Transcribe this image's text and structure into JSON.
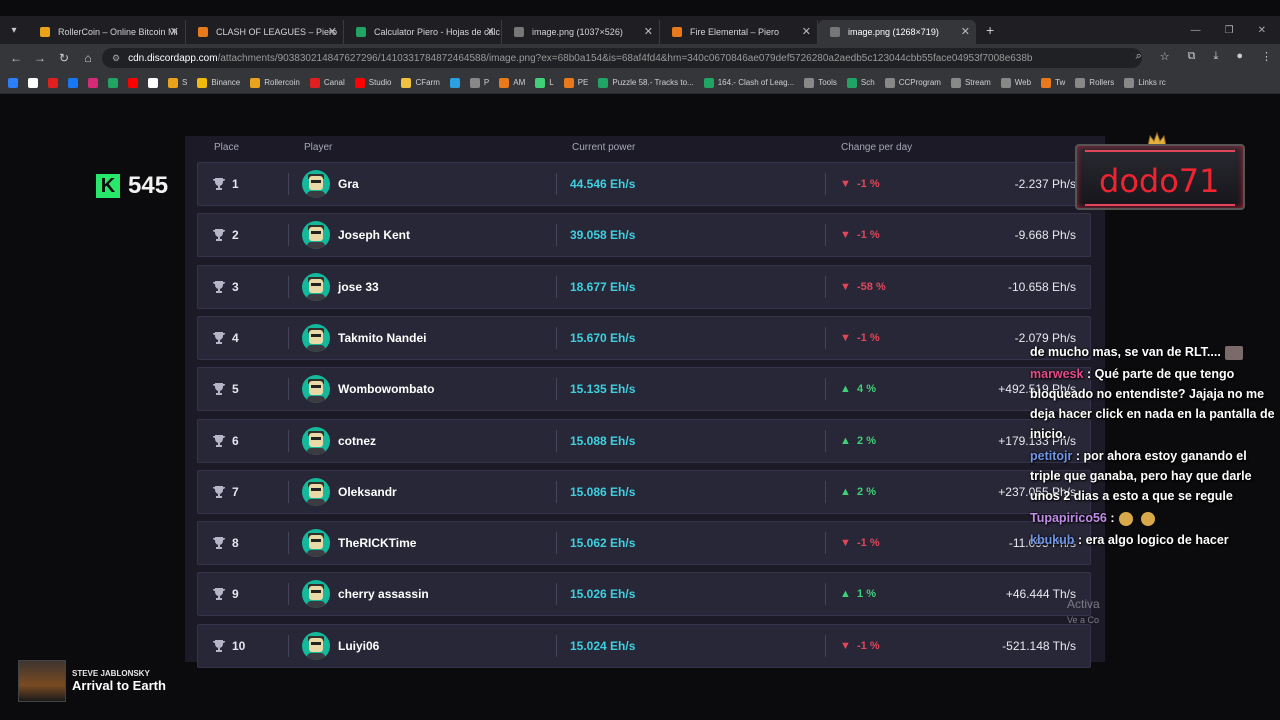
{
  "browser": {
    "tabs": [
      {
        "title": "RollerCoin – Online Bitcoin Mi",
        "color": "#e8a21b",
        "active": false
      },
      {
        "title": "CLASH OF LEAGUES – Piero",
        "color": "#e87a1b",
        "active": false
      },
      {
        "title": "Calculator Piero - Hojas de cálc",
        "color": "#1fa463",
        "active": false
      },
      {
        "title": "image.png (1037×526)",
        "color": "#777777",
        "active": false
      },
      {
        "title": "Fire Elemental – Piero",
        "color": "#e87a1b",
        "active": false
      },
      {
        "title": "image.png (1268×719)",
        "color": "#777777",
        "active": true
      }
    ],
    "url_host": "cdn.discordapp.com",
    "url_path": "/attachments/903830214847627296/1410331784872464588/image.png?ex=68b0a154&is=68af4fd4&hm=340c0670846ae079def5726280a2aedb5c123044cbb55face04953f7008e638b",
    "bookmarks": [
      {
        "label": "",
        "color": "#2d7ff9"
      },
      {
        "label": "",
        "color": "#ffffff"
      },
      {
        "label": "",
        "color": "#e02020"
      },
      {
        "label": "",
        "color": "#1877f2"
      },
      {
        "label": "",
        "color": "#d62976"
      },
      {
        "label": "",
        "color": "#1fa463"
      },
      {
        "label": "",
        "color": "#ff0000"
      },
      {
        "label": "",
        "color": "#ffffff"
      },
      {
        "label": "S",
        "color": "#e8a21b"
      },
      {
        "label": "Binance",
        "color": "#f0b90b"
      },
      {
        "label": "Rollercoin",
        "color": "#e8a21b"
      },
      {
        "label": "Canal",
        "color": "#e02020"
      },
      {
        "label": "Studio",
        "color": "#ff0000"
      },
      {
        "label": "CFarm",
        "color": "#f0c040"
      },
      {
        "label": "",
        "color": "#2aa0e0"
      },
      {
        "label": "P",
        "color": "#888888"
      },
      {
        "label": "AM",
        "color": "#e87a1b"
      },
      {
        "label": "L",
        "color": "#3fd078"
      },
      {
        "label": "PE",
        "color": "#e87a1b"
      },
      {
        "label": "Puzzle 58.- Tracks to...",
        "color": "#1fa463"
      },
      {
        "label": "164.- Clash of Leag...",
        "color": "#1fa463"
      },
      {
        "label": "Tools",
        "color": "#888888"
      },
      {
        "label": "Sch",
        "color": "#1fa463"
      },
      {
        "label": "CCProgram",
        "color": "#888888"
      },
      {
        "label": "Stream",
        "color": "#888888"
      },
      {
        "label": "Web",
        "color": "#888888"
      },
      {
        "label": "Tw",
        "color": "#e87a1b"
      },
      {
        "label": "Rollers",
        "color": "#888888"
      },
      {
        "label": "Links rc",
        "color": "#888888"
      }
    ]
  },
  "leaderboard": {
    "headers": {
      "place": "Place",
      "player": "Player",
      "power": "Current power",
      "change": "Change per day"
    },
    "rows": [
      {
        "place": "1",
        "player": "Gra",
        "power": "44.546 Eh/s",
        "dir": "down",
        "change": "-1 %",
        "perday": "-2.237 Ph/s"
      },
      {
        "place": "2",
        "player": "Joseph Kent",
        "power": "39.058 Eh/s",
        "dir": "down",
        "change": "-1 %",
        "perday": "-9.668 Ph/s"
      },
      {
        "place": "3",
        "player": "jose 33",
        "power": "18.677 Eh/s",
        "dir": "down",
        "change": "-58 %",
        "perday": "-10.658 Eh/s"
      },
      {
        "place": "4",
        "player": "Takmito Nandei",
        "power": "15.670 Eh/s",
        "dir": "down",
        "change": "-1 %",
        "perday": "-2.079 Ph/s"
      },
      {
        "place": "5",
        "player": "Wombowombato",
        "power": "15.135 Eh/s",
        "dir": "up",
        "change": "4 %",
        "perday": "+492.519 Ph/s"
      },
      {
        "place": "6",
        "player": "cotnez",
        "power": "15.088 Eh/s",
        "dir": "up",
        "change": "2 %",
        "perday": "+179.133 Ph/s"
      },
      {
        "place": "7",
        "player": "Oleksandr",
        "power": "15.086 Eh/s",
        "dir": "up",
        "change": "2 %",
        "perday": "+237.055 Ph/s"
      },
      {
        "place": "8",
        "player": "TheRICKTime",
        "power": "15.062 Eh/s",
        "dir": "down",
        "change": "-1 %",
        "perday": "-11.095 Ph/s"
      },
      {
        "place": "9",
        "player": "cherry assassin",
        "power": "15.026 Eh/s",
        "dir": "up",
        "change": "1 %",
        "perday": "+46.444 Th/s"
      },
      {
        "place": "10",
        "player": "Luiyi06",
        "power": "15.024 Eh/s",
        "dir": "down",
        "change": "-1 %",
        "perday": "-521.148 Th/s"
      }
    ]
  },
  "overlay": {
    "kick_count": "545",
    "streamer_name": "dodo71",
    "chat": [
      {
        "user": "",
        "text": "de mucho mas, se van de RLT....",
        "cls": ""
      },
      {
        "user": "marwesk",
        "text": ": Qué parte de que tengo bloqueado no entendiste? Jajaja no me deja hacer click en nada en la pantalla de inicio.",
        "cls": "u-green"
      },
      {
        "user": "petitojr",
        "text": ": por ahora estoy ganando el triple que ganaba, pero hay que darle unos 2 dias a esto a que se regule",
        "cls": "u-blue"
      },
      {
        "user": "Tupapirico56",
        "text": ":",
        "cls": "u-purple"
      },
      {
        "user": "kbukub",
        "text": ": era algo logico de hacer",
        "cls": "u-blue"
      }
    ],
    "activate_line1": "Activa",
    "activate_line2": "Ve a Co",
    "music_artist": "STEVE JABLONSKY",
    "music_song": "Arrival to Earth"
  }
}
